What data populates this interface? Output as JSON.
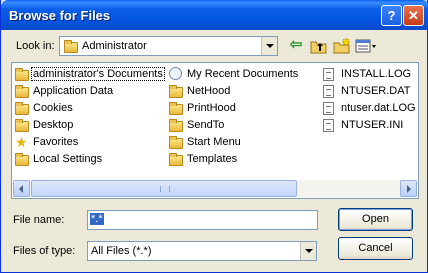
{
  "window": {
    "title": "Browse for Files",
    "help_glyph": "?",
    "close_glyph": "✕"
  },
  "look_in": {
    "label": "Look in:",
    "value": "Administrator"
  },
  "toolbar": {
    "back_icon": "back-arrow-icon",
    "up_icon": "up-one-level-icon",
    "new_folder_icon": "new-folder-icon",
    "view_menu_icon": "view-menu-icon"
  },
  "files": {
    "col1": [
      {
        "label": "administrator's Documents",
        "icon": "folder-icon",
        "selected": true
      },
      {
        "label": "Application Data",
        "icon": "folder-icon"
      },
      {
        "label": "Cookies",
        "icon": "folder-icon"
      },
      {
        "label": "Desktop",
        "icon": "folder-icon"
      },
      {
        "label": "Favorites",
        "icon": "star-icon"
      },
      {
        "label": "Local Settings",
        "icon": "folder-icon"
      }
    ],
    "col2": [
      {
        "label": "My Recent Documents",
        "icon": "recent-icon"
      },
      {
        "label": "NetHood",
        "icon": "folder-icon"
      },
      {
        "label": "PrintHood",
        "icon": "folder-icon"
      },
      {
        "label": "SendTo",
        "icon": "folder-icon"
      },
      {
        "label": "Start Menu",
        "icon": "folder-icon"
      },
      {
        "label": "Templates",
        "icon": "folder-icon"
      }
    ],
    "col3": [
      {
        "label": "INSTALL.LOG",
        "icon": "document-icon"
      },
      {
        "label": "NTUSER.DAT",
        "icon": "document-icon"
      },
      {
        "label": "ntuser.dat.LOG",
        "icon": "document-icon"
      },
      {
        "label": "NTUSER.INI",
        "icon": "document-icon"
      }
    ]
  },
  "file_name": {
    "label": "File name:",
    "value": "*.*"
  },
  "file_type": {
    "label": "Files of type:",
    "value": "All Files (*.*)"
  },
  "buttons": {
    "open": "Open",
    "cancel": "Cancel"
  },
  "colors": {
    "title_bar": "#0a5fe8",
    "selection": "#316ac5",
    "dialog_bg": "#ece9d8"
  }
}
